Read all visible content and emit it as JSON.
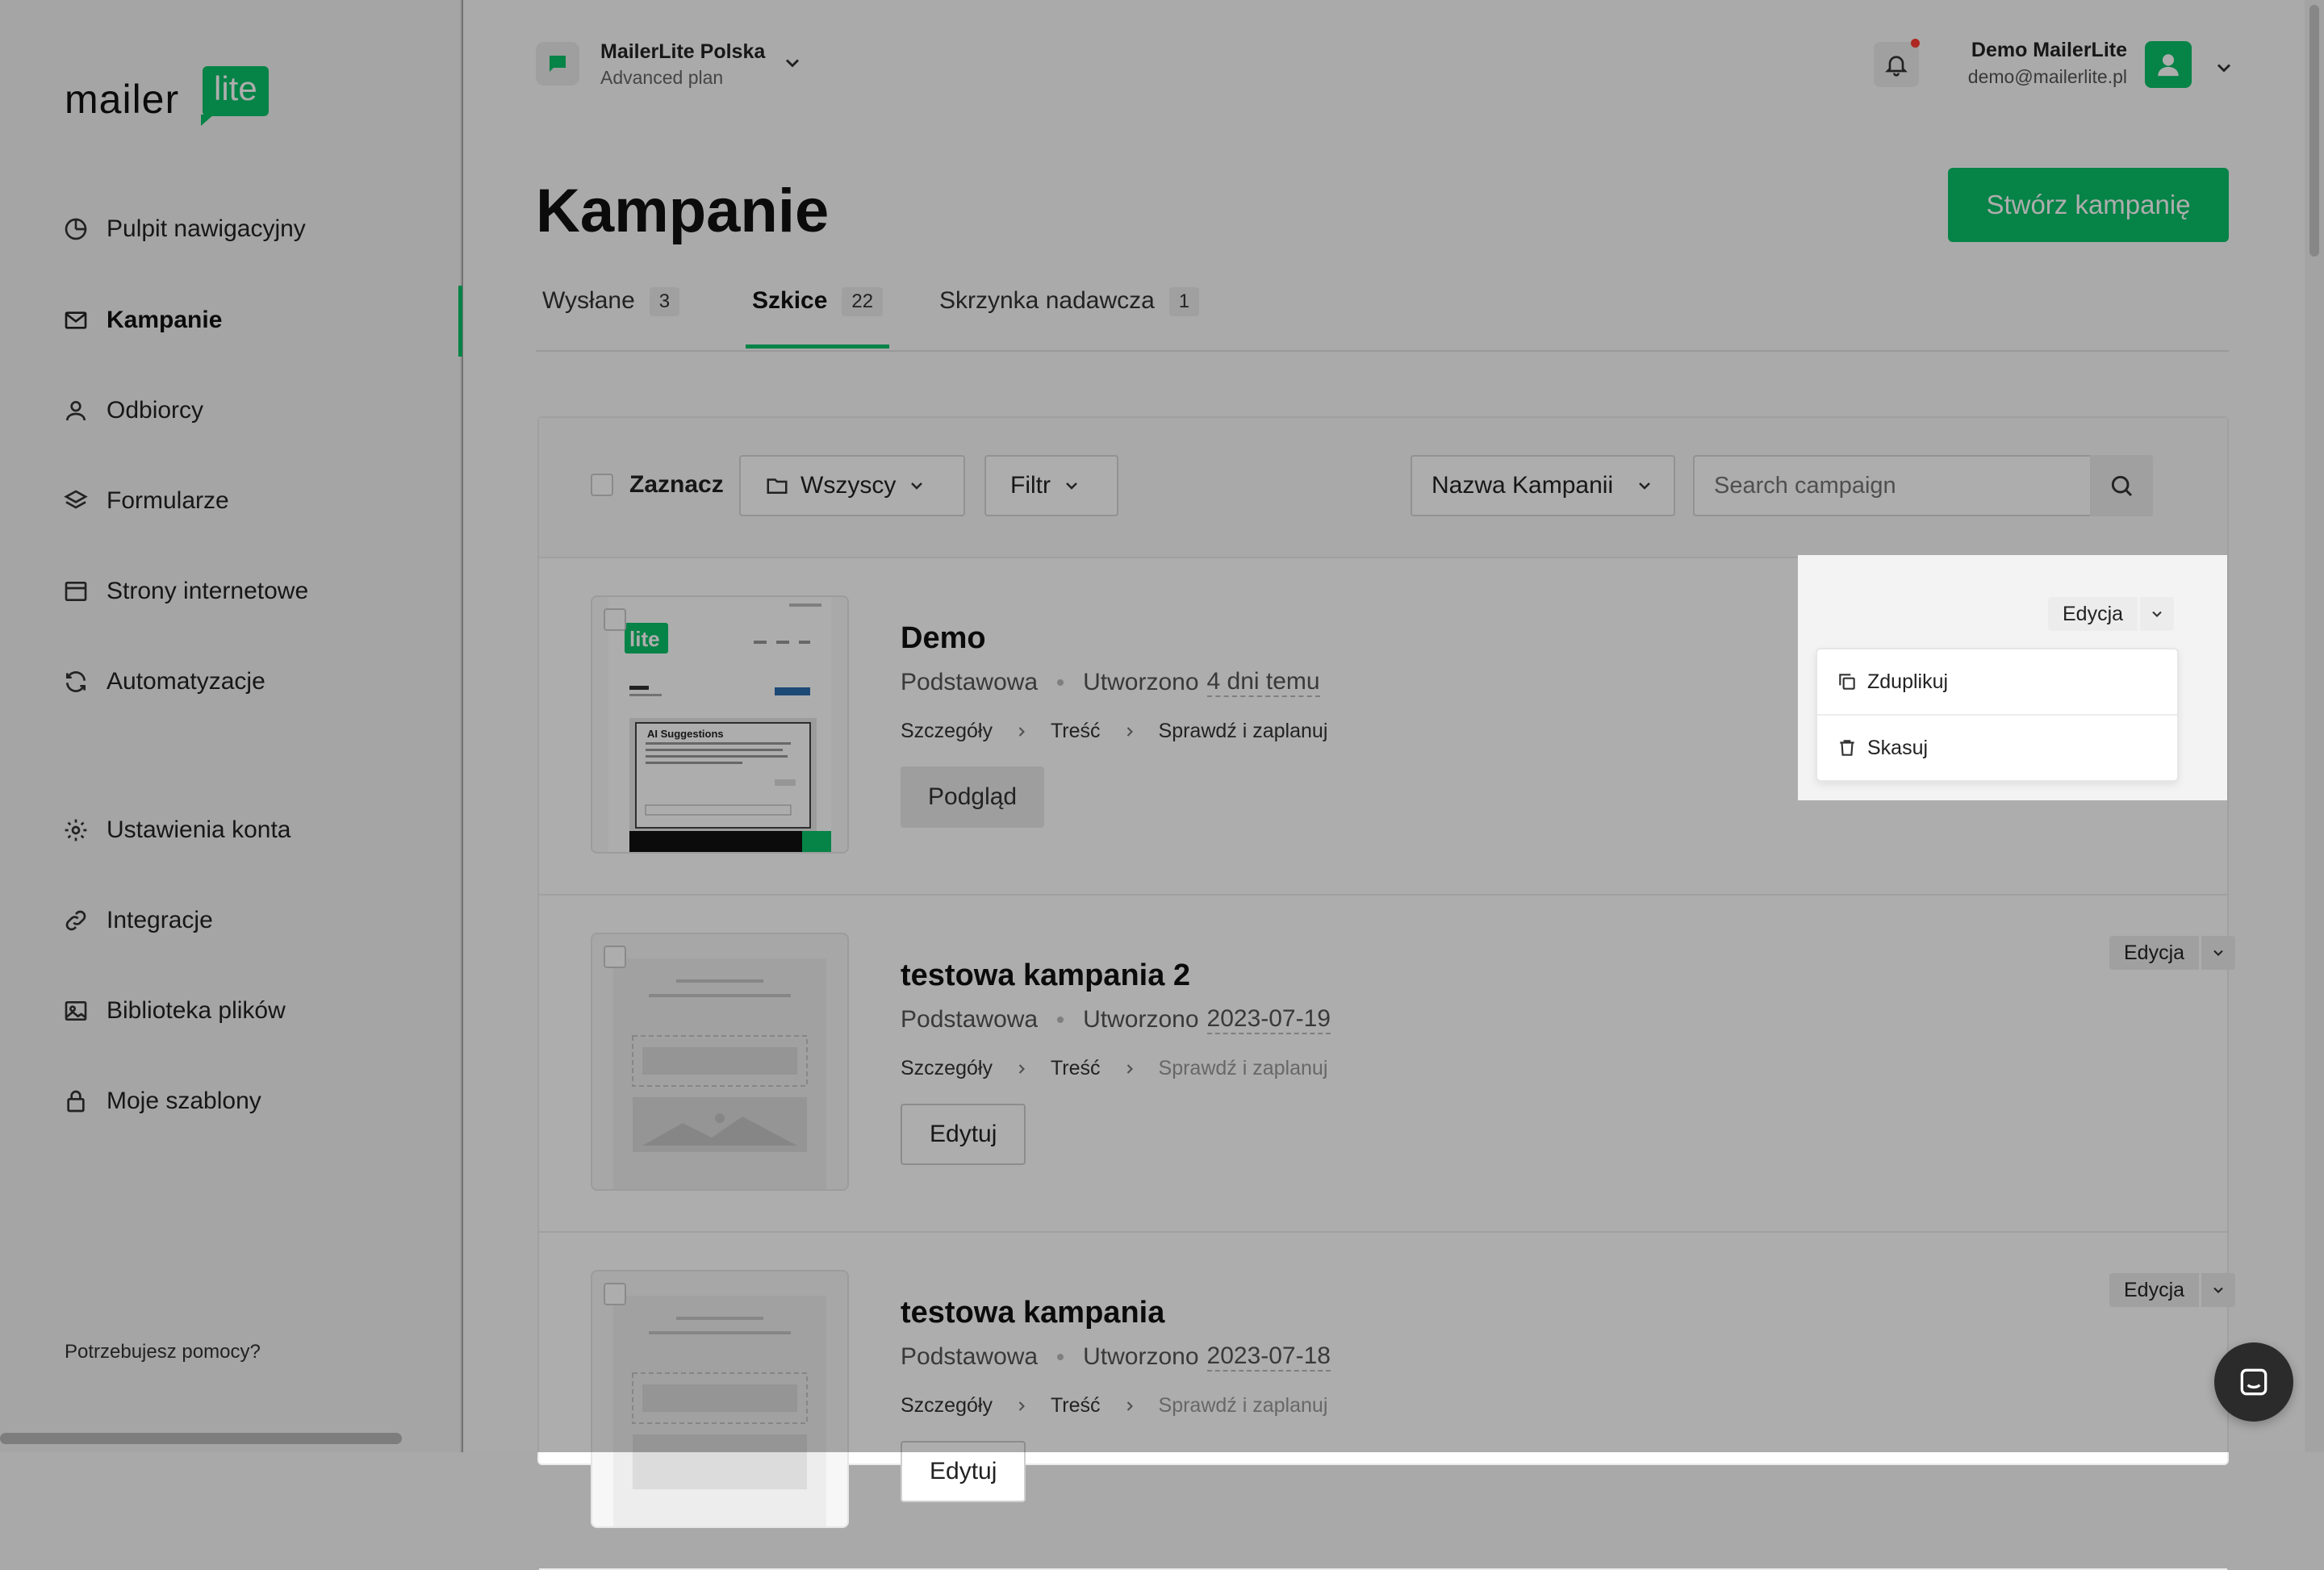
{
  "brand": {
    "logo_text": "mailer",
    "logo_badge": "lite",
    "accent_color": "#09c269"
  },
  "sidebar": {
    "items": [
      {
        "label": "Pulpit nawigacyjny",
        "icon": "dashboard-icon"
      },
      {
        "label": "Kampanie",
        "icon": "mail-icon",
        "active": true
      },
      {
        "label": "Odbiorcy",
        "icon": "user-icon"
      },
      {
        "label": "Formularze",
        "icon": "layers-icon"
      },
      {
        "label": "Strony internetowe",
        "icon": "browser-icon"
      },
      {
        "label": "Automatyzacje",
        "icon": "refresh-icon"
      }
    ],
    "secondary": [
      {
        "label": "Ustawienia konta",
        "icon": "gear-icon"
      },
      {
        "label": "Integracje",
        "icon": "link-icon"
      },
      {
        "label": "Biblioteka plików",
        "icon": "image-icon"
      },
      {
        "label": "Moje szablony",
        "icon": "lock-icon"
      }
    ],
    "help": "Potrzebujesz pomocy?"
  },
  "header": {
    "account_name": "MailerLite Polska",
    "account_plan": "Advanced plan",
    "user_name": "Demo MailerLite",
    "user_email": "demo@mailerlite.pl"
  },
  "page": {
    "title": "Kampanie",
    "create_button": "Stwórz kampanię",
    "tabs": [
      {
        "label": "Wysłane",
        "count": "3"
      },
      {
        "label": "Szkice",
        "count": "22",
        "active": true
      },
      {
        "label": "Skrzynka nadawcza",
        "count": "1"
      }
    ]
  },
  "toolbar": {
    "select_label": "Zaznacz",
    "folder_dropdown": "Wszyscy",
    "filter_dropdown": "Filtr",
    "sort_dropdown": "Nazwa Kampanii",
    "search_placeholder": "Search campaign"
  },
  "campaigns": [
    {
      "title": "Demo",
      "type": "Podstawowa",
      "created_prefix": "Utworzono",
      "created": "4 dni temu",
      "steps": [
        "Szczegóły",
        "Treść",
        "Sprawdź i zaplanuj"
      ],
      "button": "Podgląd",
      "edit": "Edycja"
    },
    {
      "title": "testowa kampania 2",
      "type": "Podstawowa",
      "created_prefix": "Utworzono",
      "created": "2023-07-19",
      "steps": [
        "Szczegóły",
        "Treść",
        "Sprawdź i zaplanuj"
      ],
      "button": "Edytuj",
      "edit": "Edycja"
    },
    {
      "title": "testowa kampania",
      "type": "Podstawowa",
      "created_prefix": "Utworzono",
      "created": "2023-07-18",
      "steps": [
        "Szczegóły",
        "Treść",
        "Sprawdź i zaplanuj"
      ],
      "button": "Edytuj",
      "edit": "Edycja"
    }
  ],
  "dropdown_menu": {
    "edit_label": "Edycja",
    "items": [
      {
        "label": "Zduplikuj",
        "icon": "copy-icon"
      },
      {
        "label": "Skasuj",
        "icon": "trash-icon"
      }
    ]
  },
  "thumb_text": {
    "badge": "lite",
    "ai_title": "AI Suggestions"
  }
}
